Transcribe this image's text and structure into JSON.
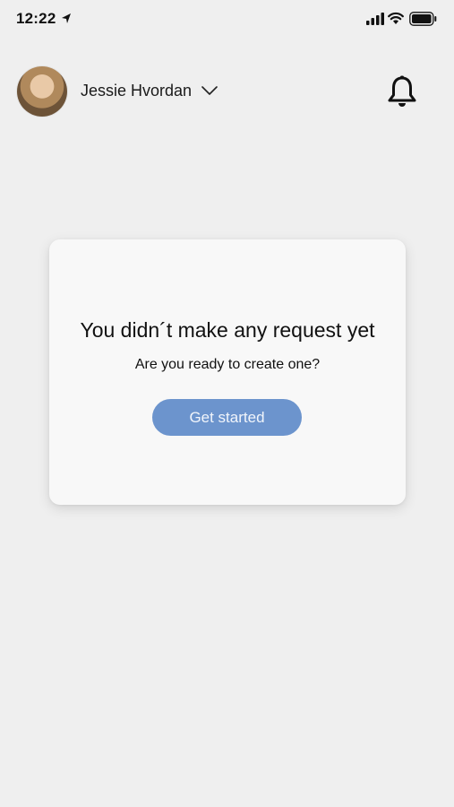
{
  "status_bar": {
    "time": "12:22",
    "icons": [
      "location-arrow-icon",
      "signal-icon",
      "wifi-icon",
      "battery-icon"
    ]
  },
  "header": {
    "user_name": "Jessie Hvordan",
    "icons": [
      "avatar",
      "chevron-down-icon",
      "bell-icon"
    ]
  },
  "empty_state": {
    "title": "You didn´t make any request yet",
    "subtitle": "Are you ready to create one?",
    "button_label": "Get started"
  },
  "colors": {
    "background": "#efefef",
    "card": "#f8f8f8",
    "accent_button": "#6c94cd"
  }
}
